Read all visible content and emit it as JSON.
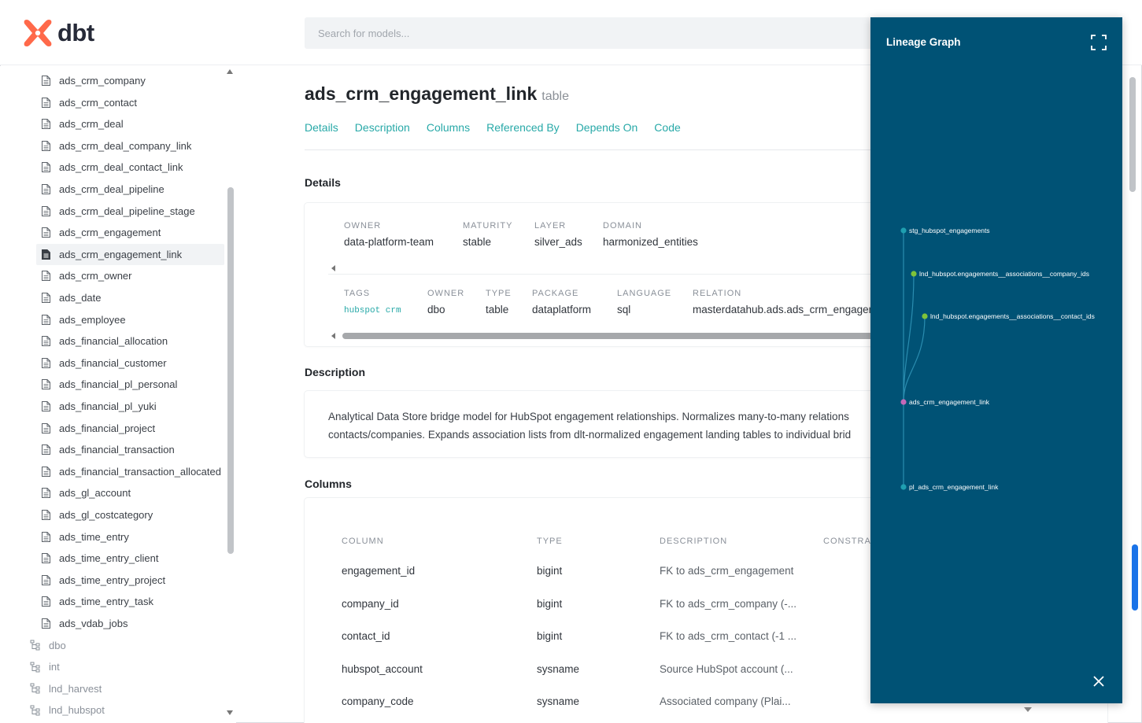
{
  "header": {
    "logo_text": "dbt",
    "search_placeholder": "Search for models..."
  },
  "sidebar": {
    "models": [
      "ads_crm_company",
      "ads_crm_contact",
      "ads_crm_deal",
      "ads_crm_deal_company_link",
      "ads_crm_deal_contact_link",
      "ads_crm_deal_pipeline",
      "ads_crm_deal_pipeline_stage",
      "ads_crm_engagement",
      "ads_crm_engagement_link",
      "ads_crm_owner",
      "ads_date",
      "ads_employee",
      "ads_financial_allocation",
      "ads_financial_customer",
      "ads_financial_pl_personal",
      "ads_financial_pl_yuki",
      "ads_financial_project",
      "ads_financial_transaction",
      "ads_financial_transaction_allocated",
      "ads_gl_account",
      "ads_gl_costcategory",
      "ads_time_entry",
      "ads_time_entry_client",
      "ads_time_entry_project",
      "ads_time_entry_task",
      "ads_vdab_jobs"
    ],
    "selected": "ads_crm_engagement_link",
    "schemas": [
      "dbo",
      "int",
      "lnd_harvest",
      "lnd_hubspot"
    ]
  },
  "model": {
    "name": "ads_crm_engagement_link",
    "type": "table",
    "tabs": [
      "Details",
      "Description",
      "Columns",
      "Referenced By",
      "Depends On",
      "Code"
    ]
  },
  "details": {
    "section_title": "Details",
    "meta": [
      {
        "label": "OWNER",
        "value": "data-platform-team"
      },
      {
        "label": "MATURITY",
        "value": "stable"
      },
      {
        "label": "LAYER",
        "value": "silver_ads"
      },
      {
        "label": "DOMAIN",
        "value": "harmonized_entities"
      }
    ],
    "info": [
      {
        "label": "TAGS",
        "value": "hubspot crm"
      },
      {
        "label": "OWNER",
        "value": "dbo"
      },
      {
        "label": "TYPE",
        "value": "table"
      },
      {
        "label": "PACKAGE",
        "value": "dataplatform"
      },
      {
        "label": "LANGUAGE",
        "value": "sql"
      },
      {
        "label": "RELATION",
        "value": "masterdatahub.ads.ads_crm_engager"
      }
    ]
  },
  "description": {
    "section_title": "Description",
    "line1": "Analytical Data Store bridge model for HubSpot engagement relationships. Normalizes many-to-many relations",
    "line2": "contacts/companies. Expands association lists from dlt-normalized engagement landing tables to individual brid"
  },
  "columns": {
    "section_title": "Columns",
    "headers": [
      "COLUMN",
      "TYPE",
      "DESCRIPTION",
      "CONSTRA"
    ],
    "rows": [
      {
        "name": "engagement_id",
        "type": "bigint",
        "description": "FK to ads_crm_engagement"
      },
      {
        "name": "company_id",
        "type": "bigint",
        "description": "FK to ads_crm_company (-..."
      },
      {
        "name": "contact_id",
        "type": "bigint",
        "description": "FK to ads_crm_contact (-1 ..."
      },
      {
        "name": "hubspot_account",
        "type": "sysname",
        "description": "Source HubSpot account (..."
      },
      {
        "name": "company_code",
        "type": "sysname",
        "description": "Associated company (Plai..."
      }
    ]
  },
  "lineage": {
    "title": "Lineage Graph",
    "nodes": [
      {
        "label": "stg_hubspot_engagements",
        "color": "#1f9fb0"
      },
      {
        "label": "lnd_hubspot.engagements__associations__company_ids",
        "color": "#7ec33a"
      },
      {
        "label": "lnd_hubspot.engagements__associations__contact_ids",
        "color": "#7ec33a"
      },
      {
        "label": "ads_crm_engagement_link",
        "color": "#c569b8"
      },
      {
        "label": "pl_ads_crm_engagement_link",
        "color": "#1f9fb0"
      }
    ]
  },
  "colors": {
    "accent": "#28a9a8",
    "lineage_bg": "#005275",
    "logo": "#ff694a"
  }
}
